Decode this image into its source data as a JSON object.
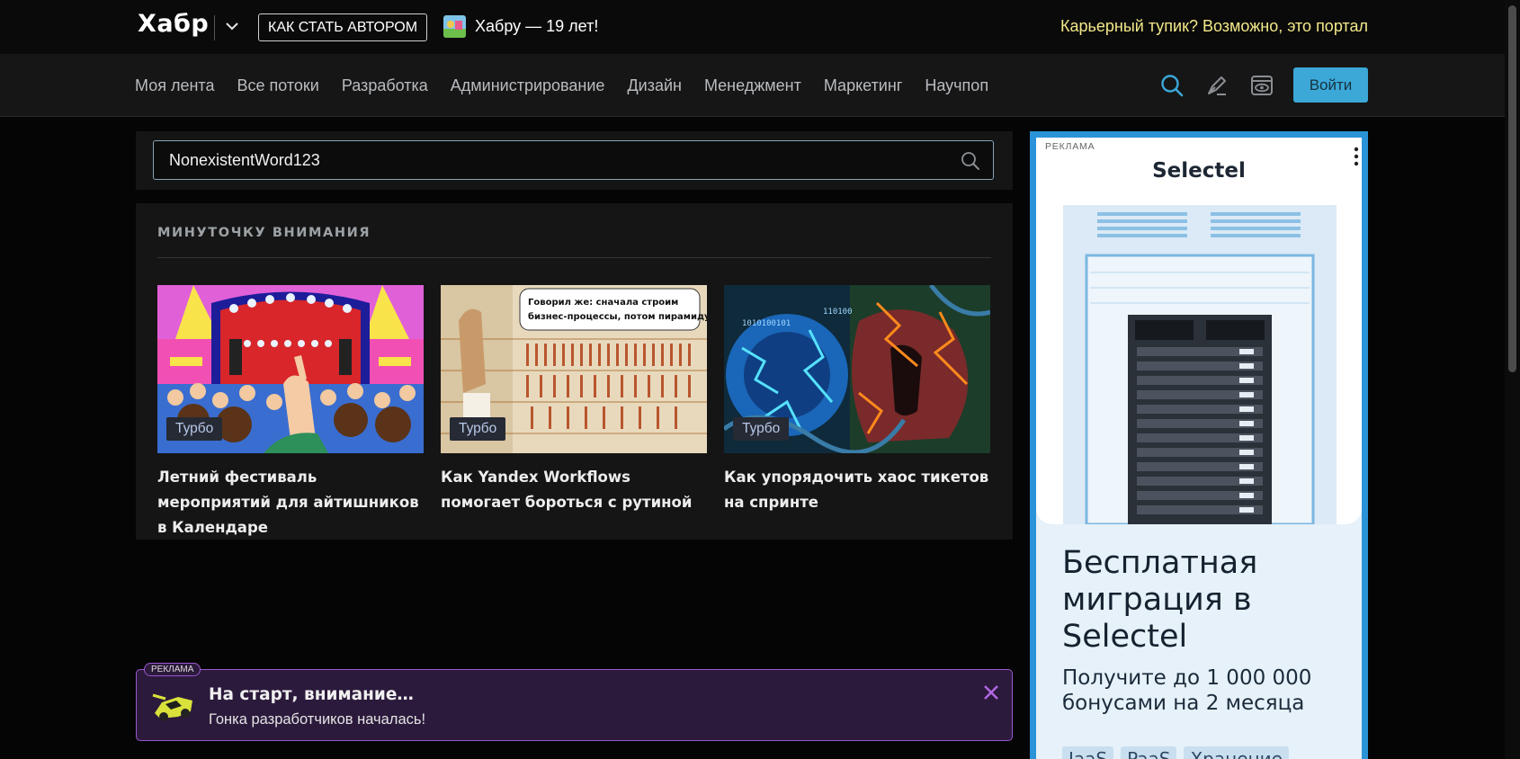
{
  "topbar": {
    "logo": "Хабр",
    "become_author": "КАК СТАТЬ АВТОРОМ",
    "anniversary": "Хабру — 19 лет!",
    "promo": "Карьерный тупик? Возможно, это портал"
  },
  "nav": {
    "items": [
      "Моя лента",
      "Все потоки",
      "Разработка",
      "Администрирование",
      "Дизайн",
      "Менеджмент",
      "Маркетинг",
      "Научпоп"
    ],
    "login": "Войти",
    "accent_color": "#3ba8d8"
  },
  "search": {
    "value": "NonexistentWord123"
  },
  "attention": {
    "title": "МИНУТОЧКУ ВНИМАНИЯ",
    "cards": [
      {
        "badge": "Турбо",
        "title": "Летний фестиваль мероприятий для айтишников в Календаре"
      },
      {
        "badge": "Турбо",
        "title": "Как Yandex Workflows помогает бороться с рутиной",
        "bubble_line1": "Говорил же: сначала строим",
        "bubble_line2": "бизнес-процессы, потом пирамиду."
      },
      {
        "badge": "Турбо",
        "title": "Как упорядочить хаос тикетов на спринте"
      }
    ]
  },
  "ad_banner": {
    "label": "РЕКЛАМА",
    "title": "На старт, внимание…",
    "subtitle": "Гонка разработчиков началась!",
    "border_color": "#9a57cf"
  },
  "side_ad": {
    "label": "РЕКЛАМА",
    "brand": "Selectel",
    "headline": "Бесплатная миграция в Selectel",
    "sub": "Получите до 1 000 000 бонусами на 2 месяца",
    "tags": [
      "IaaS",
      "PaaS",
      "Хранение"
    ]
  }
}
